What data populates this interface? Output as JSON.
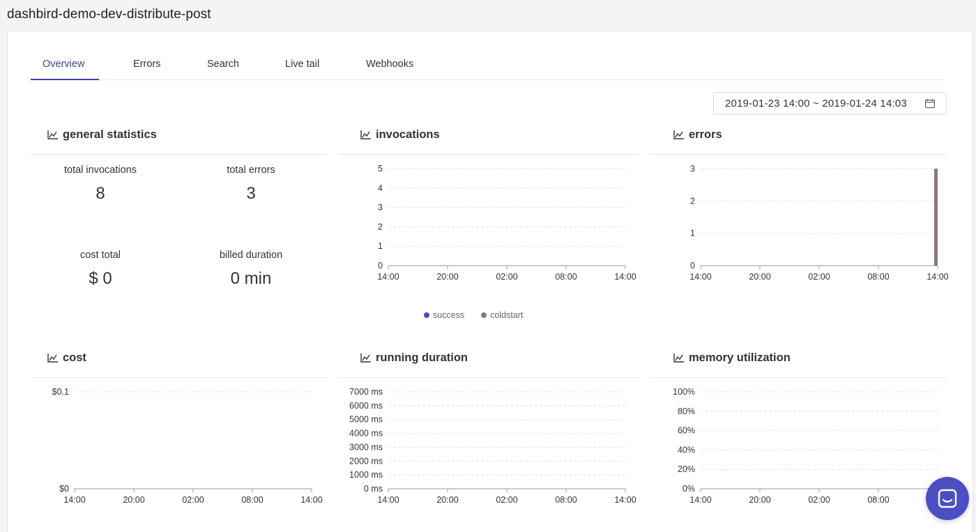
{
  "page_title": "dashbird-demo-dev-distribute-post",
  "tabs": [
    {
      "label": "Overview",
      "active": true
    },
    {
      "label": "Errors",
      "active": false
    },
    {
      "label": "Search",
      "active": false
    },
    {
      "label": "Live tail",
      "active": false
    },
    {
      "label": "Webhooks",
      "active": false
    }
  ],
  "date_range": "2019-01-23 14:00 ~ 2019-01-24 14:03",
  "colors": {
    "accent": "#3b3fa8",
    "success": "#4a4fc4",
    "coldstart": "#8a7a7a",
    "chat_button": "#4a4fc4"
  },
  "general_statistics": {
    "title": "general statistics",
    "total_invocations_label": "total invocations",
    "total_invocations": "8",
    "total_errors_label": "total errors",
    "total_errors": "3",
    "cost_total_label": "cost total",
    "cost_total": "$ 0",
    "billed_duration_label": "billed duration",
    "billed_duration": "0 min"
  },
  "panels": {
    "invocations": {
      "title": "invocations"
    },
    "errors": {
      "title": "errors"
    },
    "cost": {
      "title": "cost"
    },
    "running_duration": {
      "title": "running duration"
    },
    "memory_utilization": {
      "title": "memory utilization"
    }
  },
  "legend": [
    {
      "label": "success",
      "color": "#4a4fc4"
    },
    {
      "label": "coldstart",
      "color": "#8a7a7a"
    }
  ],
  "chart_data": [
    {
      "id": "invocations",
      "type": "bar",
      "title": "invocations",
      "x_ticks": [
        "14:00",
        "20:00",
        "02:00",
        "08:00",
        "14:00"
      ],
      "y_ticks": [
        "0",
        "1",
        "2",
        "3",
        "4",
        "5"
      ],
      "ylim": [
        0,
        5
      ],
      "grid": true,
      "legend": "bottom",
      "series": [
        {
          "name": "success",
          "values": []
        },
        {
          "name": "coldstart",
          "values": []
        }
      ]
    },
    {
      "id": "errors",
      "type": "bar",
      "title": "errors",
      "x_ticks": [
        "14:00",
        "20:00",
        "02:00",
        "08:00",
        "14:00"
      ],
      "y_ticks": [
        "0",
        "1",
        "2",
        "3"
      ],
      "ylim": [
        0,
        3
      ],
      "grid": true,
      "series": [
        {
          "values": [
            {
              "x": "14:00",
              "y": 3
            }
          ]
        }
      ]
    },
    {
      "id": "cost",
      "type": "line",
      "title": "cost",
      "x_ticks": [
        "14:00",
        "20:00",
        "02:00",
        "08:00",
        "14:00"
      ],
      "y_ticks": [
        "$0",
        "$0.1"
      ],
      "ylim": [
        0,
        0.1
      ],
      "grid": true,
      "series": []
    },
    {
      "id": "running_duration",
      "type": "line",
      "title": "running duration",
      "x_ticks": [
        "14:00",
        "20:00",
        "02:00",
        "08:00",
        "14:00"
      ],
      "y_ticks": [
        "0 ms",
        "1000 ms",
        "2000 ms",
        "3000 ms",
        "4000 ms",
        "5000 ms",
        "6000 ms",
        "7000 ms"
      ],
      "ylim": [
        0,
        7000
      ],
      "grid": true,
      "series": []
    },
    {
      "id": "memory_utilization",
      "type": "line",
      "title": "memory utilization",
      "x_ticks": [
        "14:00",
        "20:00",
        "02:00",
        "08:00",
        "14:00"
      ],
      "y_ticks": [
        "0%",
        "20%",
        "40%",
        "60%",
        "80%",
        "100%"
      ],
      "ylim": [
        0,
        100
      ],
      "grid": true,
      "series": []
    }
  ]
}
